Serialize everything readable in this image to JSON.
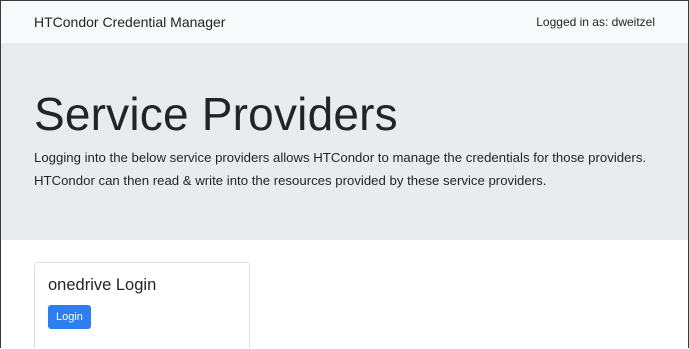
{
  "navbar": {
    "brand": "HTCondor Credential Manager",
    "logged_in_text": "Logged in as: dweitzel"
  },
  "jumbotron": {
    "title": "Service Providers",
    "lead_line1": "Logging into the below service providers allows HTCondor to manage the credentials for those providers.",
    "lead_line2": "HTCondor can then read & write into the resources provided by these service providers."
  },
  "providers": [
    {
      "title": "onedrive Login",
      "button_label": "Login"
    }
  ],
  "colors": {
    "navbar_bg": "#f8f9fa",
    "jumbotron_bg": "#e9ecef",
    "primary_button": "#2f7ef0"
  }
}
